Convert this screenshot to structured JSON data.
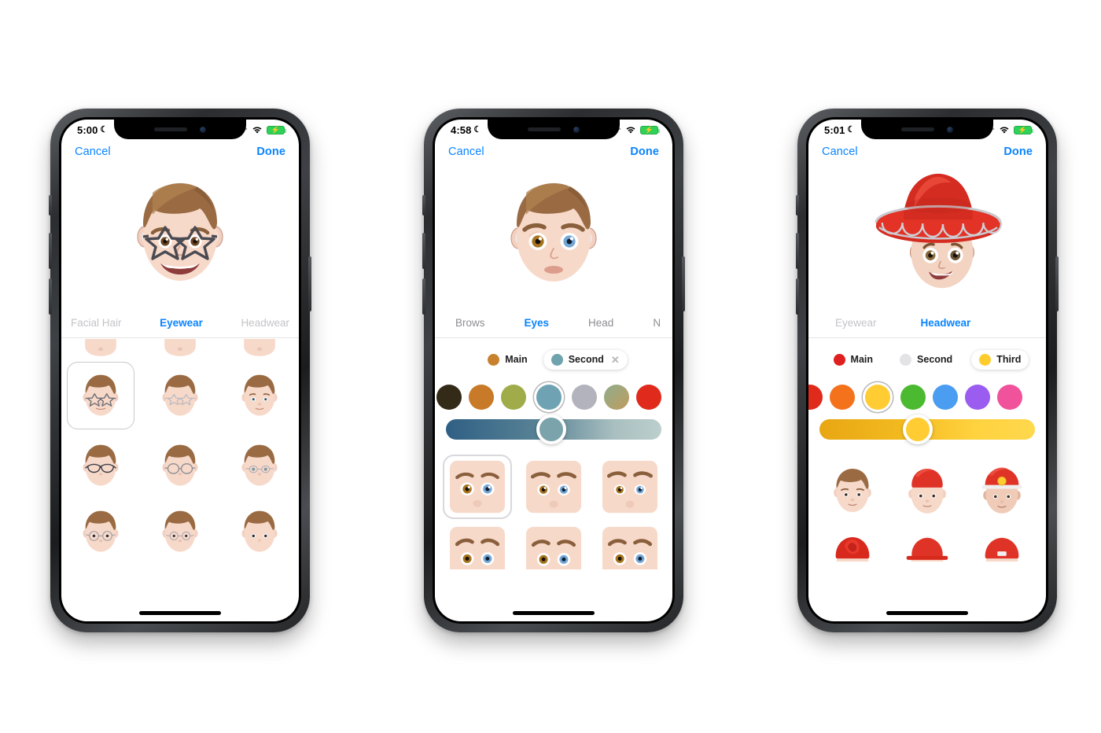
{
  "phones": [
    {
      "id": "phone-eyewear",
      "status": {
        "time": "5:00",
        "moon_icon": "crescent-moon-icon",
        "airplane_icon": "airplane-mode-icon",
        "wifi_icon": "wifi-icon",
        "battery_icon": "battery-charging-icon",
        "green_dot": "recording-indicator"
      },
      "nav": {
        "cancel": "Cancel",
        "done": "Done"
      },
      "tabs": [
        {
          "label": "Facial Hair",
          "state": "faded"
        },
        {
          "label": "Eyewear",
          "state": "active"
        },
        {
          "label": "Headwear",
          "state": "faded"
        }
      ],
      "panel_type": "grid-only",
      "grid": {
        "selected_index": 3,
        "items": [
          "face-partial-1",
          "face-partial-2",
          "face-partial-3",
          "star-glasses-dark",
          "star-glasses-clear",
          "no-eyewear",
          "cateye-glasses",
          "round-glasses",
          "thin-oval-glasses",
          "wire-round-glasses",
          "thin-round-glasses",
          "no-eyewear-alt"
        ]
      }
    },
    {
      "id": "phone-eyes",
      "status": {
        "time": "4:58",
        "moon_icon": "crescent-moon-icon",
        "airplane_icon": "airplane-mode-icon",
        "wifi_icon": "wifi-icon",
        "battery_icon": "battery-charging-icon",
        "green_dot": "recording-indicator"
      },
      "nav": {
        "cancel": "Cancel",
        "done": "Done"
      },
      "tabs": [
        {
          "label": "Brows",
          "state": "normal"
        },
        {
          "label": "Eyes",
          "state": "active"
        },
        {
          "label": "Head",
          "state": "normal"
        },
        {
          "label": "N",
          "state": "clipped"
        }
      ],
      "panel_type": "color",
      "color_pills": [
        {
          "label": "Main",
          "color": "#c8822f",
          "selected": false,
          "has_close": false
        },
        {
          "label": "Second",
          "color": "#6fa3ae",
          "selected": true,
          "has_close": true,
          "close_icon": "close-icon"
        }
      ],
      "swatches": [
        {
          "color": "#332a17",
          "selected": false
        },
        {
          "color": "#c87a28",
          "selected": false
        },
        {
          "color": "#a0ab4a",
          "selected": false
        },
        {
          "color": "#6fa3b4",
          "selected": true
        },
        {
          "color": "#b3b3bd",
          "selected": false
        },
        {
          "color": "#88a281",
          "selected": false
        },
        {
          "color": "#e02a1c",
          "selected": false
        }
      ],
      "slider": {
        "from": "#2f5f84",
        "to": "#b3c6c6",
        "thumb_color": "#7ba3ac",
        "value_pct": 49
      },
      "grid": {
        "selected_index": 0,
        "items": [
          "eyes-heterochromia-wide",
          "eyes-heterochromia-round",
          "eyes-heterochromia-narrow",
          "eyes-row2-a",
          "eyes-row2-b",
          "eyes-row2-c"
        ]
      }
    },
    {
      "id": "phone-headwear",
      "status": {
        "time": "5:01",
        "moon_icon": "crescent-moon-icon",
        "airplane_icon": "airplane-mode-icon",
        "wifi_icon": "wifi-icon",
        "battery_icon": "battery-charging-icon",
        "green_dot": "recording-indicator"
      },
      "nav": {
        "cancel": "Cancel",
        "done": "Done"
      },
      "tabs": [
        {
          "label": "Eyewear",
          "state": "faded"
        },
        {
          "label": "Headwear",
          "state": "active"
        }
      ],
      "panel_type": "color",
      "color_pills": [
        {
          "label": "Main",
          "color": "#e02020",
          "selected": false,
          "has_close": false
        },
        {
          "label": "Second",
          "color": "#e3e3e6",
          "selected": false,
          "has_close": false
        },
        {
          "label": "Third",
          "color": "#ffcc2e",
          "selected": true,
          "has_close": false
        }
      ],
      "swatches": [
        {
          "color": "#e02a1c",
          "selected": false
        },
        {
          "color": "#f5721d",
          "selected": false
        },
        {
          "color": "#ffcc33",
          "selected": true
        },
        {
          "color": "#4cba30",
          "selected": false
        },
        {
          "color": "#4a9df0",
          "selected": false
        },
        {
          "color": "#9b5cf0",
          "selected": false
        },
        {
          "color": "#f0539b",
          "selected": false
        }
      ],
      "slider": {
        "from": "#e8a613",
        "to": "#ffd84d",
        "thumb_color": "#ffcc33",
        "value_pct": 46
      },
      "grid": {
        "selected_index": -1,
        "items": [
          "no-headwear",
          "red-beanie",
          "red-cap-gold-emblem",
          "red-turban",
          "red-cap",
          "red-helmet"
        ]
      }
    }
  ]
}
